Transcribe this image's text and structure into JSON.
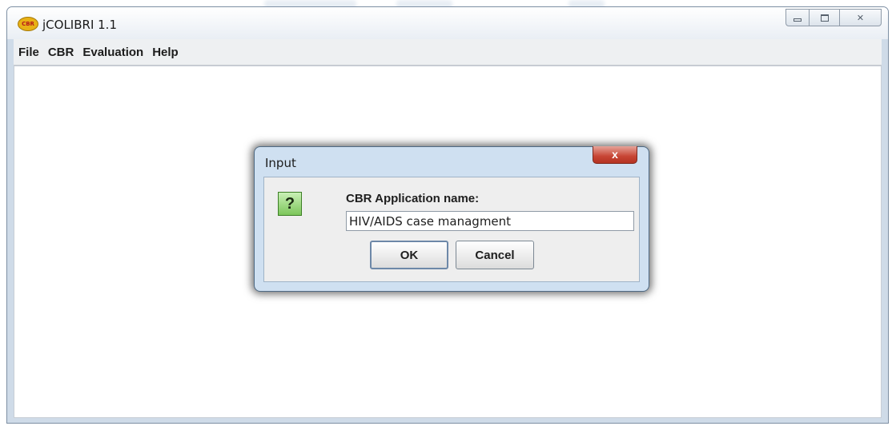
{
  "window": {
    "title": "jCOLIBRI 1.1",
    "icon_text": "CBR"
  },
  "menu": [
    "File",
    "CBR",
    "Evaluation",
    "Help"
  ],
  "dialog": {
    "title": "Input",
    "close_glyph": "x",
    "question_glyph": "?",
    "label": "CBR Application name:",
    "input_value": "HIV/AIDS case managment",
    "ok_label": "OK",
    "cancel_label": "Cancel"
  },
  "colors": {
    "dialog_close": "#c74534",
    "question_icon": "#7cc65a",
    "app_icon": "#e8b116"
  }
}
